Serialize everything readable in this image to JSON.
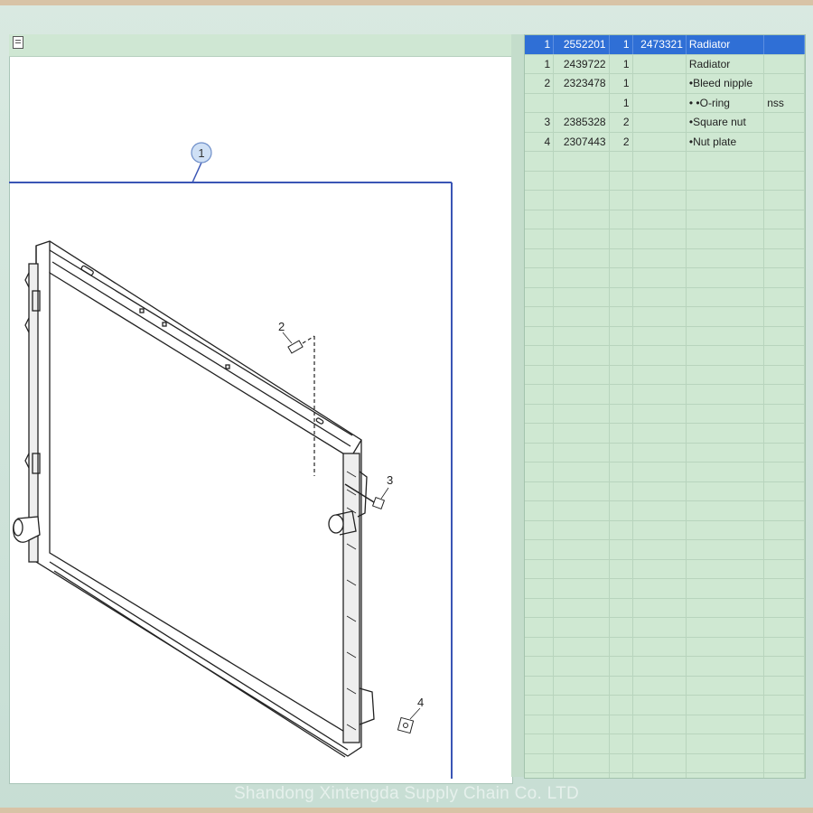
{
  "diagram": {
    "callouts": [
      "1",
      "2",
      "3",
      "4"
    ]
  },
  "parts_table": {
    "rows": [
      {
        "pos": "1",
        "part_no": "2552201",
        "qty": "1",
        "ref": "2473321",
        "description": "Radiator",
        "note": "",
        "selected": true
      },
      {
        "pos": "1",
        "part_no": "2439722",
        "qty": "1",
        "ref": "",
        "description": "Radiator",
        "note": ""
      },
      {
        "pos": "2",
        "part_no": "2323478",
        "qty": "1",
        "ref": "",
        "description": "•Bleed nipple",
        "note": ""
      },
      {
        "pos": "",
        "part_no": "",
        "qty": "1",
        "ref": "",
        "description": "• •O-ring",
        "note": "nss"
      },
      {
        "pos": "3",
        "part_no": "2385328",
        "qty": "2",
        "ref": "",
        "description": "•Square nut",
        "note": ""
      },
      {
        "pos": "4",
        "part_no": "2307443",
        "qty": "2",
        "ref": "",
        "description": "•Nut plate",
        "note": ""
      }
    ]
  },
  "watermark": "Shandong Xintengda Supply Chain Co. LTD",
  "colors": {
    "selected_row": "#2f6fd6",
    "list_background": "#cfe8d2",
    "callout_fill": "#cfe0f5"
  },
  "icons": [
    "document-icon"
  ]
}
